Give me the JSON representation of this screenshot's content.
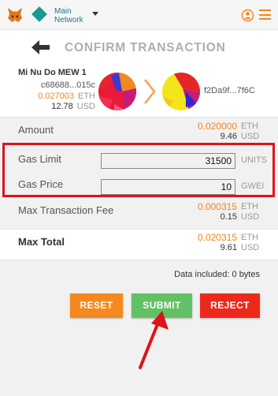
{
  "header": {
    "network_label_line1": "Main",
    "network_label_line2": "Network",
    "icons": [
      "metamask-fox-icon",
      "network-diamond-icon",
      "caret-down-icon",
      "account-switch-icon",
      "hamburger-menu-icon"
    ]
  },
  "page": {
    "title": "CONFIRM TRANSACTION"
  },
  "from_account": {
    "name": "Mi Nu Do MEW 1",
    "address": "c68688...015c",
    "balance_eth": "0.027003",
    "balance_eth_unit": "ETH",
    "balance_usd": "12.78",
    "balance_usd_unit": "USD"
  },
  "to_account": {
    "address": "f2Da9f...7f6C"
  },
  "details": {
    "amount": {
      "label": "Amount",
      "eth": "0.020000",
      "eth_unit": "ETH",
      "usd": "9.46",
      "usd_unit": "USD"
    },
    "gas_limit": {
      "label": "Gas Limit",
      "value": "31500",
      "unit": "UNITS"
    },
    "gas_price": {
      "label": "Gas Price",
      "value": "10",
      "unit": "GWEI"
    },
    "max_fee": {
      "label": "Max Transaction Fee",
      "eth": "0.000315",
      "eth_unit": "ETH",
      "usd": "0.15",
      "usd_unit": "USD"
    },
    "max_total": {
      "label": "Max Total",
      "eth": "0.020315",
      "eth_unit": "ETH",
      "usd": "9.61",
      "usd_unit": "USD"
    }
  },
  "data_included": "Data included: 0 bytes",
  "buttons": {
    "reset": "RESET",
    "submit": "SUBMIT",
    "reject": "REJECT"
  },
  "colors": {
    "accent_orange": "#f5841f",
    "submit_green": "#62c164",
    "reject_red": "#ec2a1c",
    "reset_orange": "#f5891f",
    "annotation_red": "#e0131a",
    "network_teal": "#1a9a8d"
  }
}
